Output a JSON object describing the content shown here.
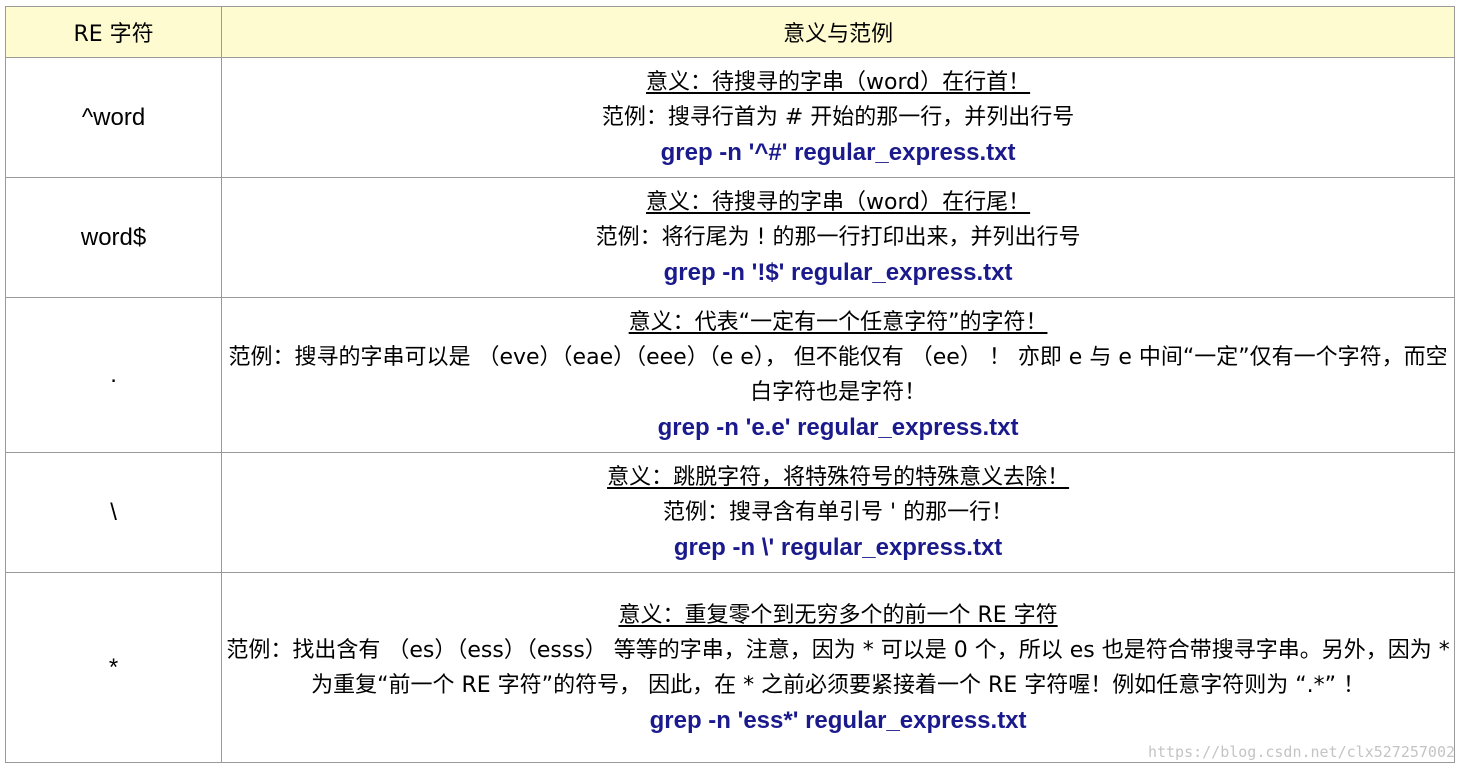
{
  "header": {
    "col_re": "RE 字符",
    "col_desc": "意义与范例"
  },
  "rows": [
    {
      "re": "^word",
      "meaning": "意义：待搜寻的字串（word）在行首！",
      "example": "范例：搜寻行首为 # 开始的那一行，并列出行号",
      "command": "grep -n '^#' regular_express.txt"
    },
    {
      "re": "word$",
      "meaning": "意义：待搜寻的字串（word）在行尾！",
      "example": "范例：将行尾为 ! 的那一行打印出来，并列出行号",
      "command": "grep -n '!$' regular_express.txt"
    },
    {
      "re": ".",
      "meaning": "意义：代表“一定有一个任意字符”的字符！",
      "example": "范例：搜寻的字串可以是 （eve）（eae）（eee）（e e）， 但不能仅有 （ee） ！ 亦即 e 与 e 中间“一定”仅有一个字符，而空白字符也是字符！",
      "command": "grep -n 'e.e' regular_express.txt"
    },
    {
      "re": "\\",
      "meaning": "意义：跳脱字符，将特殊符号的特殊意义去除！",
      "example": "范例：搜寻含有单引号 ' 的那一行！",
      "command": "grep -n \\' regular_express.txt"
    },
    {
      "re": "*",
      "meaning": "意义：重复零个到无穷多个的前一个 RE 字符",
      "example": "范例：找出含有 （es）（ess）（esss） 等等的字串，注意，因为 * 可以是 0 个，所以 es 也是符合带搜寻字串。另外，因为 * 为重复“前一个 RE 字符”的符号， 因此，在 * 之前必须要紧接着一个 RE 字符喔！例如任意字符则为 “.*” ！",
      "command": "grep -n 'ess*' regular_express.txt"
    }
  ],
  "watermark": "https://blog.csdn.net/clx527257002",
  "colors": {
    "header_bg": "#fffbd0",
    "command_color": "#1a1a8c",
    "border": "#9a9a9a"
  }
}
